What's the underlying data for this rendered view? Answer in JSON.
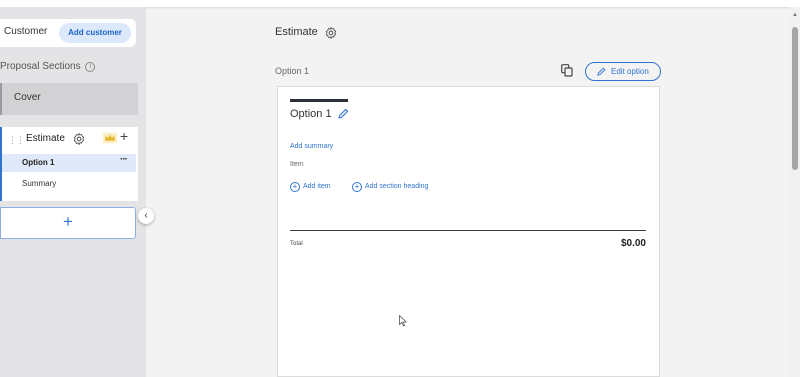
{
  "sidebar": {
    "customer_label": "Customer",
    "add_customer_label": "Add customer",
    "sections_heading": "Proposal Sections",
    "cover_label": "Cover",
    "estimate_label": "Estimate",
    "option_label": "Option 1",
    "summary_label": "Summary",
    "add_section_label": "+",
    "collapse_label": "‹"
  },
  "main": {
    "title": "Estimate",
    "option_heading": "Option 1",
    "edit_option_label": "Edit option",
    "doc": {
      "option_title": "Option 1",
      "add_summary_label": "Add summary",
      "item_label": "Item",
      "add_item_label": "Add item",
      "add_section_heading_label": "Add section heading",
      "total_label": "Total",
      "total_value": "$0.00"
    }
  },
  "icons": {
    "settings": "gear-icon",
    "info": "info-icon",
    "drag": "drag-handle-icon",
    "premium": "crown-icon",
    "add": "plus-icon",
    "more": "more-icon",
    "copy": "copy-icon",
    "edit": "pencil-icon",
    "collapse": "chevron-left-icon",
    "cursor": "mouse-cursor-icon"
  },
  "colors": {
    "accent": "#2f74d0",
    "crown": "#e6b629",
    "sidebar_bg": "#e4e4e6"
  }
}
